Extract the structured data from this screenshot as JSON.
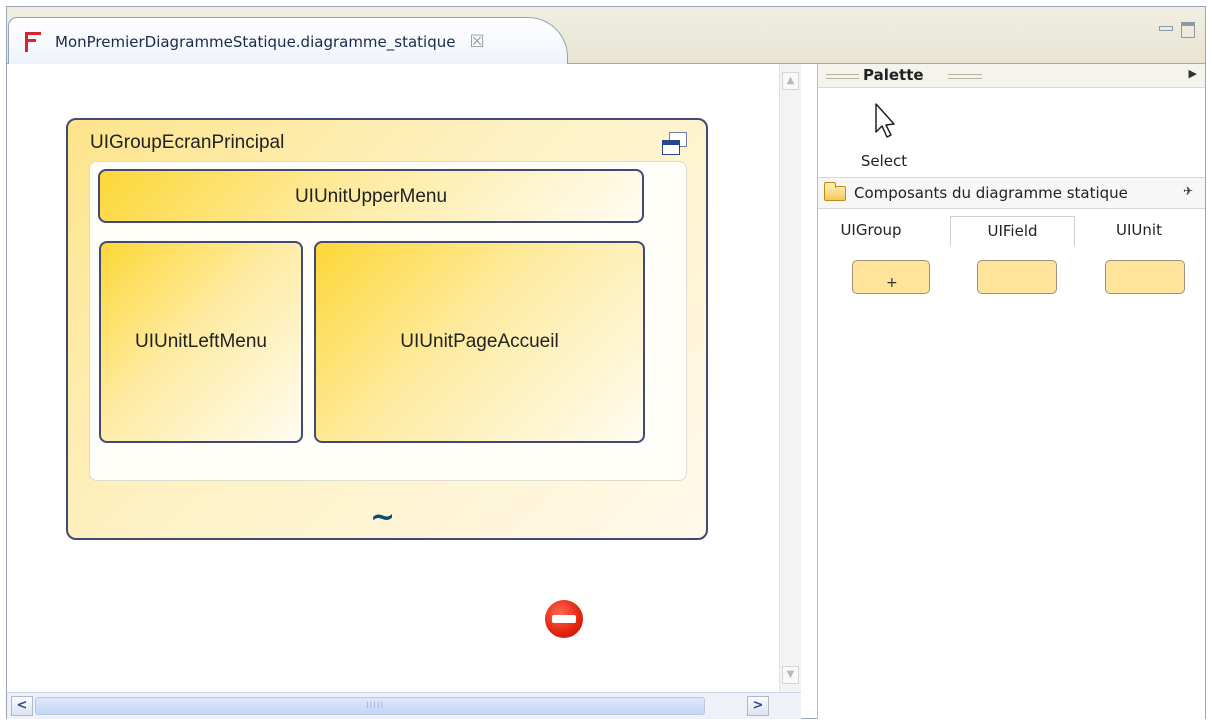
{
  "editor": {
    "tab_title": "MonPremierDiagrammeStatique.diagramme_statique",
    "tab_close": "☒"
  },
  "diagram": {
    "group_title": "UIGroupEcranPrincipal",
    "upper_menu": "UIUnitUpperMenu",
    "left_menu": "UIUnitLeftMenu",
    "page_accueil": "UIUnitPageAccueil",
    "collapse_symbol": "~",
    "no_entry_icon": "no-entry-icon"
  },
  "palette": {
    "title": "Palette",
    "select_label": "Select",
    "drawer_label": "Composants du diagramme statique",
    "tabs": [
      "UIGroup",
      "UIField",
      "UIUnit"
    ],
    "group_box_symbol": "+"
  },
  "scrollbar": {
    "left_arrow": "<",
    "right_arrow": ">",
    "grip": "IIIII"
  }
}
